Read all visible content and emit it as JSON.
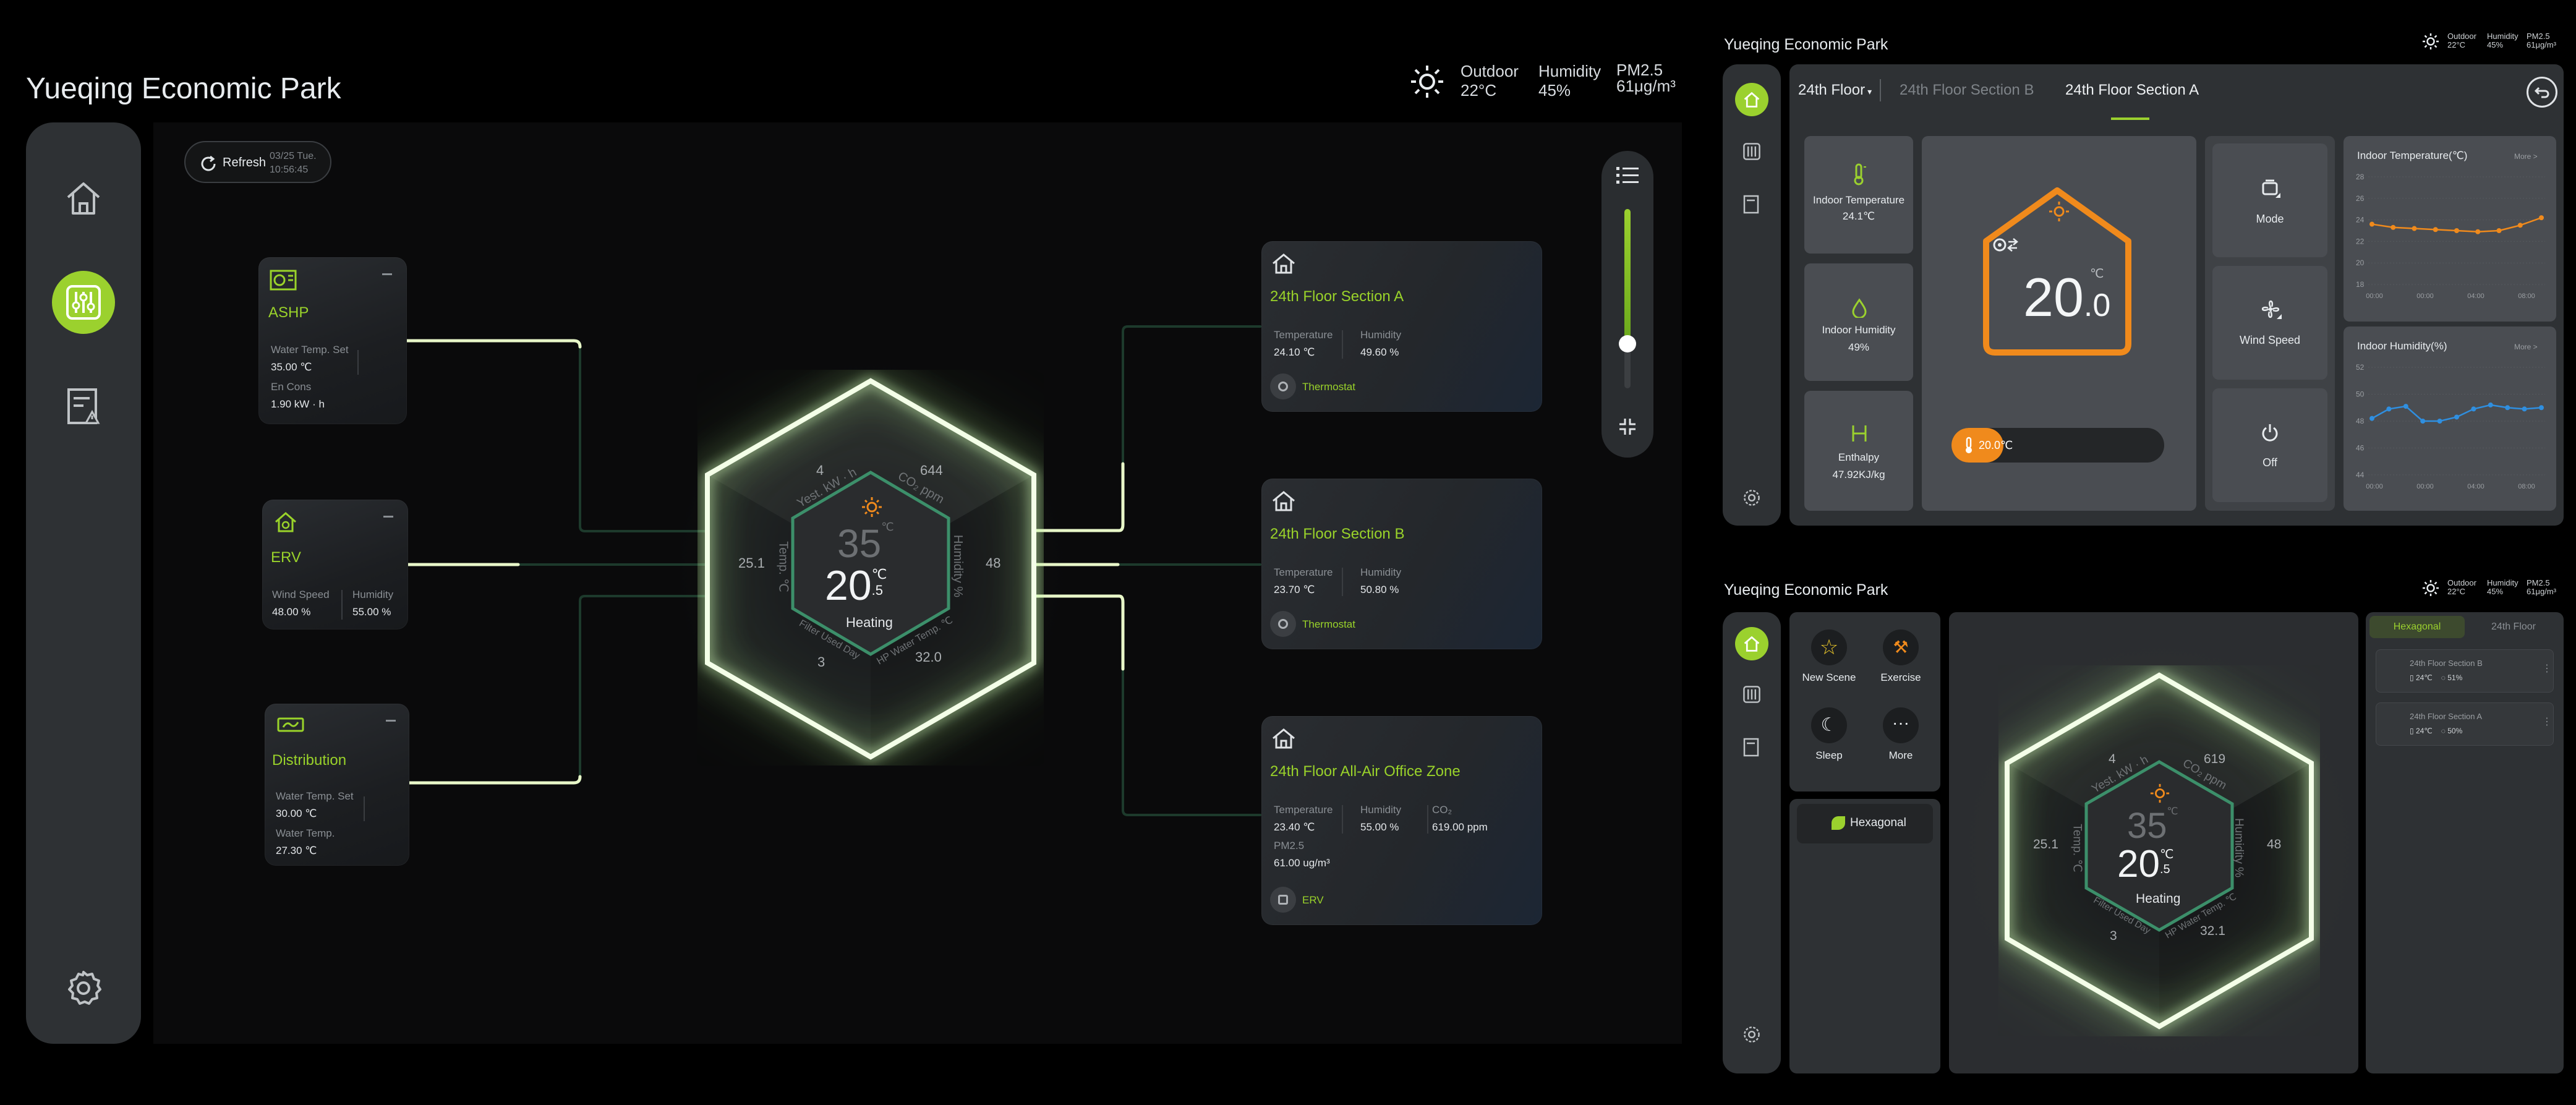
{
  "main": {
    "title": "Yueqing Economic Park",
    "weather": {
      "outdoor_label": "Outdoor",
      "outdoor_value": "22°C",
      "humidity_label": "Humidity",
      "humidity_value": "45%",
      "pm_label": "PM2.5",
      "pm_value": "61μg/m³"
    },
    "refresh": {
      "label": "Refresh",
      "date": "03/25 Tue.",
      "time": "10:56:45"
    },
    "devices": {
      "ashp": {
        "name": "ASHP",
        "l1": "Water Temp. Set",
        "v1": "35.00 ℃",
        "l2": "En Cons",
        "v2": "1.90 kW · h"
      },
      "erv": {
        "name": "ERV",
        "l1": "Wind Speed",
        "v1": "48.00 %",
        "l2": "Humidity",
        "v2": "55.00 %"
      },
      "dist": {
        "name": "Distribution",
        "l1": "Water Temp. Set",
        "v1": "30.00 ℃",
        "l2": "Water Temp.",
        "v2": "27.30 ℃"
      }
    },
    "zones": {
      "a": {
        "name": "24th Floor Section A",
        "l1": "Temperature",
        "v1": "24.10 ℃",
        "l2": "Humidity",
        "v2": "49.60 %",
        "device": "Thermostat"
      },
      "b": {
        "name": "24th Floor Section B",
        "l1": "Temperature",
        "v1": "23.70 ℃",
        "l2": "Humidity",
        "v2": "50.80 %",
        "device": "Thermostat"
      },
      "c": {
        "name": "24th Floor All-Air Office Zone",
        "l1": "Temperature",
        "v1": "23.40 ℃",
        "l2": "Humidity",
        "v2": "55.00 %",
        "l3": "CO₂",
        "v3": "619.00 ppm",
        "l4": "PM2.5",
        "v4": "61.00 ug/m³",
        "device": "ERV"
      }
    },
    "hex": {
      "set": "35",
      "set_unit": "℃",
      "temp_int": "20",
      "temp_unit": "℃",
      "temp_dec": ".5",
      "mode": "Heating",
      "top_left_val": "4",
      "top_left_label": "Yest. kW · h",
      "top_right_val": "644",
      "top_right_label": "CO₂ ppm",
      "left_val": "25.1",
      "left_label": "Temp. ℃",
      "right_val": "48",
      "right_label": "Humidity %",
      "bottom_left_val": "3",
      "bottom_left_label": "Filter Used Day",
      "bottom_right_val": "32.0",
      "bottom_right_label": "HP Water Temp. ℃"
    },
    "slider_level": 0.25
  },
  "panel1": {
    "title": "Yueqing Economic Park",
    "weather": {
      "outdoor_label": "Outdoor",
      "outdoor_value": "22°C",
      "humidity_label": "Humidity",
      "humidity_value": "45%",
      "pm_label": "PM2.5",
      "pm_value": "61μg/m³"
    },
    "floor": "24th Floor",
    "tabs": [
      "24th Floor Section B",
      "24th Floor Section A"
    ],
    "indoor_temp": {
      "label": "Indoor Temperature",
      "value": "24.1℃"
    },
    "indoor_hum": {
      "label": "Indoor Humidity",
      "value": "49%"
    },
    "enthalpy": {
      "label": "Enthalpy",
      "value": "47.92KJ/kg"
    },
    "thermostat": {
      "unit": "℃",
      "int": "20",
      "dec": ".0",
      "setpoint": "20.0℃"
    },
    "controls": {
      "mode": "Mode",
      "wind": "Wind Speed",
      "off": "Off"
    },
    "chart_data": [
      {
        "type": "line",
        "title": "Indoor Temperature(℃)",
        "more": "More >",
        "x": [
          "00:00",
          "00:00",
          "04:00",
          "08:00"
        ],
        "yticks": [
          "28",
          "26",
          "24",
          "22",
          "20",
          "18"
        ],
        "ylim": [
          18,
          28
        ],
        "values": [
          23.6,
          23.3,
          23.2,
          23.1,
          23.0,
          22.9,
          23.0,
          23.5,
          24.2
        ],
        "color": "#f08a1c"
      },
      {
        "type": "line",
        "title": "Indoor Humidity(%)",
        "more": "More >",
        "x": [
          "00:00",
          "00:00",
          "04:00",
          "08:00"
        ],
        "yticks": [
          "52",
          "50",
          "48",
          "46",
          "44"
        ],
        "ylim": [
          44,
          52
        ],
        "values": [
          48.2,
          48.9,
          49.1,
          48.0,
          48.0,
          48.3,
          48.9,
          49.2,
          49.0,
          48.9,
          49.0
        ],
        "color": "#2f8fe0"
      }
    ]
  },
  "panel2": {
    "title": "Yueqing Economic Park",
    "weather": {
      "outdoor_label": "Outdoor",
      "outdoor_value": "22°C",
      "humidity_label": "Humidity",
      "humidity_value": "45%",
      "pm_label": "PM2.5",
      "pm_value": "61μg/m³"
    },
    "scenes": [
      "New Scene",
      "Exercise",
      "Sleep",
      "More"
    ],
    "hex_button": "Hexagonal",
    "tabs": [
      "Hexagonal",
      "24th Floor"
    ],
    "list": [
      {
        "name": "24th Floor Section B",
        "t": "24℃",
        "h": "51%"
      },
      {
        "name": "24th Floor Section A",
        "t": "24℃",
        "h": "50%"
      }
    ],
    "hex": {
      "set": "35",
      "set_unit": "℃",
      "temp_int": "20",
      "temp_unit": "℃",
      "temp_dec": ".5",
      "mode": "Heating",
      "top_left_val": "4",
      "top_left_label": "Yest. kW · h",
      "top_right_val": "619",
      "top_right_label": "CO₂ ppm",
      "left_val": "25.1",
      "left_label": "Temp. ℃",
      "right_val": "48",
      "right_label": "Humidity %",
      "bottom_left_val": "3",
      "bottom_left_label": "Filter Used Day",
      "bottom_right_val": "32.1",
      "bottom_right_label": "HP Water Temp. ℃"
    }
  }
}
